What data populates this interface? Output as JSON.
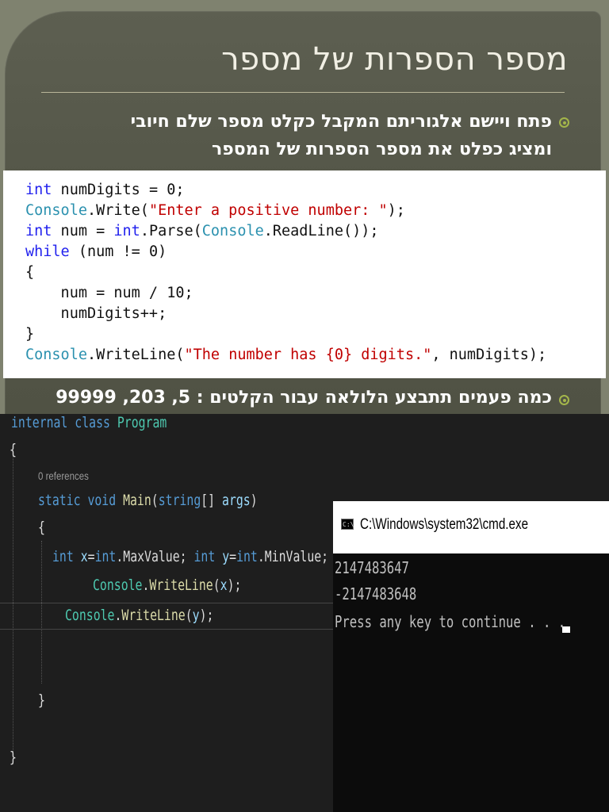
{
  "slide": {
    "title": "מספר הספרות של מספר",
    "bullet1_line1": "פתח ויישם אלגוריתם המקבל כקלט מספר שלם חיובי",
    "bullet1_line2": "ומציג כפלט את מספר הספרות של המספר",
    "bullet2": "כמה פעמים תתבצע הלולאה עבור הקלטים : 5, 203, 99999",
    "accent_color": "#a4b64a",
    "code": {
      "line1": {
        "kw": "int",
        "rest": " numDigits = 0;"
      },
      "line2": {
        "type": "Console",
        "mid": ".Write(",
        "str": "\"Enter a positive number: \"",
        "end": ");"
      },
      "line3": {
        "kw": "int",
        "mid": " num = ",
        "kw2": "int",
        "mid2": ".Parse(",
        "type": "Console",
        "end": ".ReadLine());"
      },
      "line4": {
        "kw": "while",
        "rest": " (num != 0)"
      },
      "line5": "{",
      "line6": "    num = num / 10;",
      "line7": "    numDigits++;",
      "line8": "}",
      "line9": {
        "type": "Console",
        "mid": ".WriteLine(",
        "str": "\"The number has {0} digits.\"",
        "end": ", numDigits);"
      }
    }
  },
  "editor": {
    "l1_kw": "internal class",
    "l1_cls": "Program",
    "open1": "{",
    "codelens": "0 references",
    "l3_kw": "static void",
    "l3_fn": "Main",
    "l3_p1": "(",
    "l3_kw2": "string",
    "l3_p2": "[] ",
    "l3_var": "args",
    "l3_p3": ")",
    "open2": "{",
    "l5_kw": "int",
    "l5_var1": "x",
    "l5_eq1": "=",
    "l5_kw2": "int",
    "l5_dot1": ".MaxValue; ",
    "l5_kw3": "int",
    "l5_var2": "y",
    "l5_eq2": "=",
    "l5_kw4": "int",
    "l5_dot2": ".MinValue;",
    "l6_cls": "Console",
    "l6_dot": ".",
    "l6_fn": "WriteLine",
    "l6_p1": "(",
    "l6_var": "x",
    "l6_p2": ");",
    "l7_cls": "Console",
    "l7_dot": ".",
    "l7_fn": "WriteLine",
    "l7_p1": "(",
    "l7_var": "y",
    "l7_p2": ");",
    "close2": "}",
    "close1": "}"
  },
  "console": {
    "title": "C:\\Windows\\system32\\cmd.exe",
    "icon_text": "C:\\",
    "lines": [
      "2147483647",
      "-2147483648",
      "Press any key to continue . . ."
    ]
  }
}
